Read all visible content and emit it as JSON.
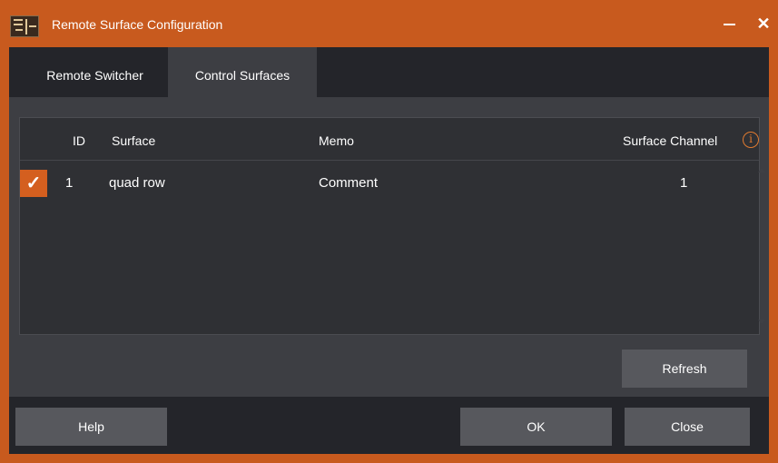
{
  "window": {
    "title": "Remote Surface Configuration",
    "minimize_icon": "minimize-icon",
    "close_label": "✕",
    "accent_color": "#c85a1e"
  },
  "tabs": [
    {
      "label": "Remote Switcher",
      "selected": false
    },
    {
      "label": "Control Surfaces",
      "selected": true
    }
  ],
  "table": {
    "headers": {
      "id": "ID",
      "surface": "Surface",
      "memo": "Memo",
      "channel": "Surface Channel"
    },
    "info_icon": "i",
    "rows": [
      {
        "checked": true,
        "check_glyph": "✓",
        "id": "1",
        "surface": "quad row",
        "memo": "Comment",
        "channel": "1"
      }
    ]
  },
  "buttons": {
    "refresh": "Refresh",
    "help": "Help",
    "ok": "OK",
    "close": "Close"
  }
}
